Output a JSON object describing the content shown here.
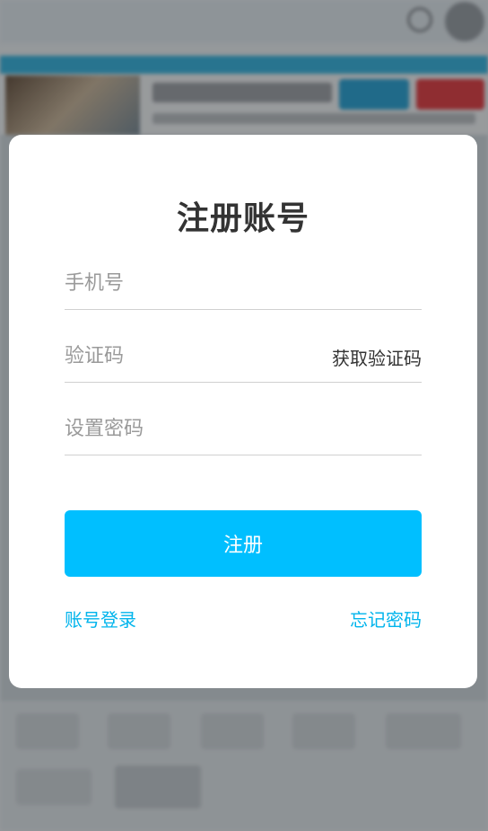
{
  "modal": {
    "title": "注册账号",
    "phone_placeholder": "手机号",
    "code_placeholder": "验证码",
    "get_code_label": "获取验证码",
    "password_placeholder": "设置密码",
    "submit_label": "注册",
    "login_link": "账号登录",
    "forgot_link": "忘记密码"
  },
  "colors": {
    "accent": "#00bfff",
    "link": "#00b4ec",
    "title": "#333333",
    "placeholder": "#9a9a9a"
  }
}
